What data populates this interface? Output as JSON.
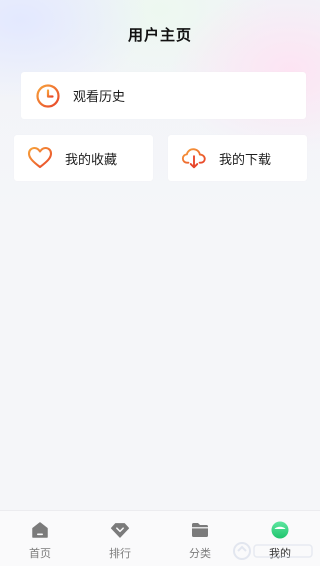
{
  "header": {
    "title": "用户主页"
  },
  "cards": {
    "history": {
      "label": "观看历史",
      "icon": "clock-icon"
    },
    "favorites": {
      "label": "我的收藏",
      "icon": "heart-icon"
    },
    "downloads": {
      "label": "我的下载",
      "icon": "cloud-download-icon"
    }
  },
  "tabbar": {
    "tabs": [
      {
        "label": "首页",
        "icon": "home-icon"
      },
      {
        "label": "排行",
        "icon": "ranking-diamond-icon"
      },
      {
        "label": "分类",
        "icon": "folder-icon"
      },
      {
        "label": "我的",
        "icon": "profile-icon",
        "active": true
      }
    ]
  },
  "colors": {
    "accent_orange": "#f06a1b",
    "accent_red": "#e8452a",
    "active_tab": "#2fd07f",
    "inactive_tab": "#7b7b7b"
  }
}
